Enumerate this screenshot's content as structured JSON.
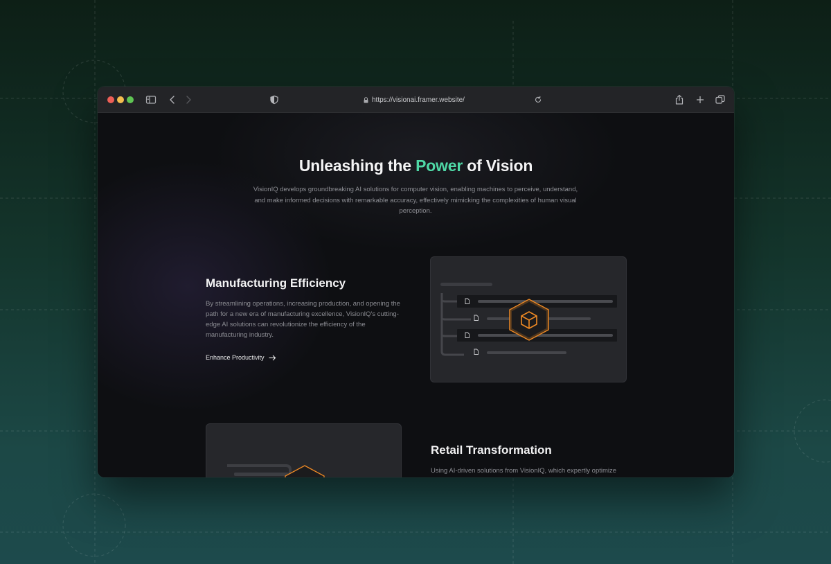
{
  "browser": {
    "url": "https://visionai.framer.website/"
  },
  "hero": {
    "title_before": "Unleashing the ",
    "title_accent": "Power",
    "title_after": " of Vision",
    "description": "VisionIQ develops groundbreaking AI solutions for computer vision, enabling machines to perceive, understand, and make informed decisions with remarkable accuracy, effectively mimicking the complexities of human visual perception."
  },
  "sections": [
    {
      "title": "Manufacturing Efficiency",
      "description": "By streamlining operations, increasing production, and opening the path for a new era of manufacturing excellence, VisionIQ's cutting-edge AI solutions can revolutionize the efficiency of the manufacturing industry.",
      "cta": "Enhance Productivity"
    },
    {
      "title": "Retail Transformation",
      "description": "Using AI-driven solutions from VisionIQ, which expertly optimize"
    }
  ],
  "colors": {
    "accent": "#4fd8a6",
    "hex_icon": "#f08a24",
    "background": "#0e0f12"
  },
  "icons": {
    "sidebar": "sidebar-icon",
    "back": "chevron-left-icon",
    "forward": "chevron-right-icon",
    "shield": "shield-icon",
    "lock": "lock-icon",
    "reload": "reload-icon",
    "share": "share-icon",
    "new_tab": "plus-icon",
    "tabs": "tabs-overview-icon",
    "arrow": "arrow-right-icon",
    "cube": "cube-icon",
    "file": "file-icon"
  }
}
